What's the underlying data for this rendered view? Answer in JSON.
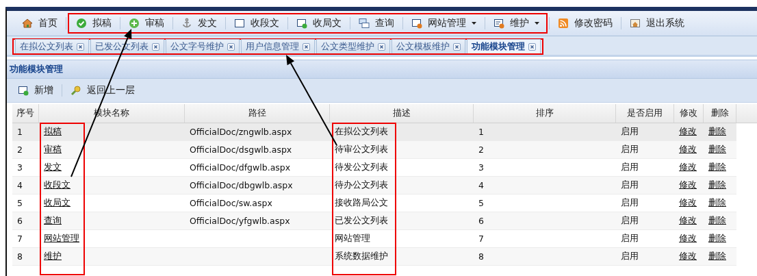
{
  "toolbar": [
    {
      "label": "首页",
      "dropdown": false
    },
    {
      "label": "拟稿",
      "dropdown": false
    },
    {
      "label": "审稿",
      "dropdown": false
    },
    {
      "label": "发文",
      "dropdown": false
    },
    {
      "label": "收段文",
      "dropdown": false
    },
    {
      "label": "收局文",
      "dropdown": false
    },
    {
      "label": "查询",
      "dropdown": false
    },
    {
      "label": "网站管理",
      "dropdown": true
    },
    {
      "label": "维护",
      "dropdown": true
    },
    {
      "label": "修改密码",
      "dropdown": false
    },
    {
      "label": "退出系统",
      "dropdown": false
    }
  ],
  "tabs": [
    {
      "label": "在拟公文列表",
      "selected": false
    },
    {
      "label": "已发公文列表",
      "selected": false
    },
    {
      "label": "公文字号维护",
      "selected": false
    },
    {
      "label": "用户信息管理",
      "selected": false
    },
    {
      "label": "公文类型维护",
      "selected": false
    },
    {
      "label": "公文模板维护",
      "selected": false
    },
    {
      "label": "功能模块管理",
      "selected": true
    }
  ],
  "panel": {
    "title": "功能模块管理",
    "actions": [
      "新增",
      "返回上一层"
    ]
  },
  "table": {
    "columns": [
      "序号",
      "模块名称",
      "路径",
      "描述",
      "排序",
      "是否启用",
      "修改",
      "删除"
    ],
    "rows": [
      {
        "selected": true,
        "cells": [
          "1",
          "拟稿",
          "OfficialDoc/zngwlb.aspx",
          "在拟公文列表",
          "1",
          "启用",
          "修改",
          "删除"
        ]
      },
      {
        "selected": false,
        "cells": [
          "2",
          "审稿",
          "OfficialDoc/dsgwlb.aspx",
          "待审公文列表",
          "2",
          "启用",
          "修改",
          "删除"
        ]
      },
      {
        "selected": false,
        "cells": [
          "3",
          "发文",
          "OfficialDoc/dfgwlb.aspx",
          "待发公文列表",
          "3",
          "启用",
          "修改",
          "删除"
        ]
      },
      {
        "selected": false,
        "cells": [
          "4",
          "收段文",
          "OfficialDoc/dbgwlb.aspx",
          "待办公文列表",
          "4",
          "启用",
          "修改",
          "删除"
        ]
      },
      {
        "selected": false,
        "cells": [
          "5",
          "收局文",
          "OfficialDoc/sw.aspx",
          "接收路局公文",
          "5",
          "启用",
          "修改",
          "删除"
        ]
      },
      {
        "selected": false,
        "cells": [
          "6",
          "查询",
          "OfficialDoc/yfgwlb.aspx",
          "已发公文列表",
          "6",
          "启用",
          "修改",
          "删除"
        ]
      },
      {
        "selected": false,
        "cells": [
          "7",
          "网站管理",
          "",
          "网站管理",
          "7",
          "启用",
          "修改",
          "删除"
        ]
      },
      {
        "selected": false,
        "cells": [
          "8",
          "维护",
          "",
          "系统数据维护",
          "8",
          "启用",
          "修改",
          "删除"
        ]
      }
    ]
  }
}
